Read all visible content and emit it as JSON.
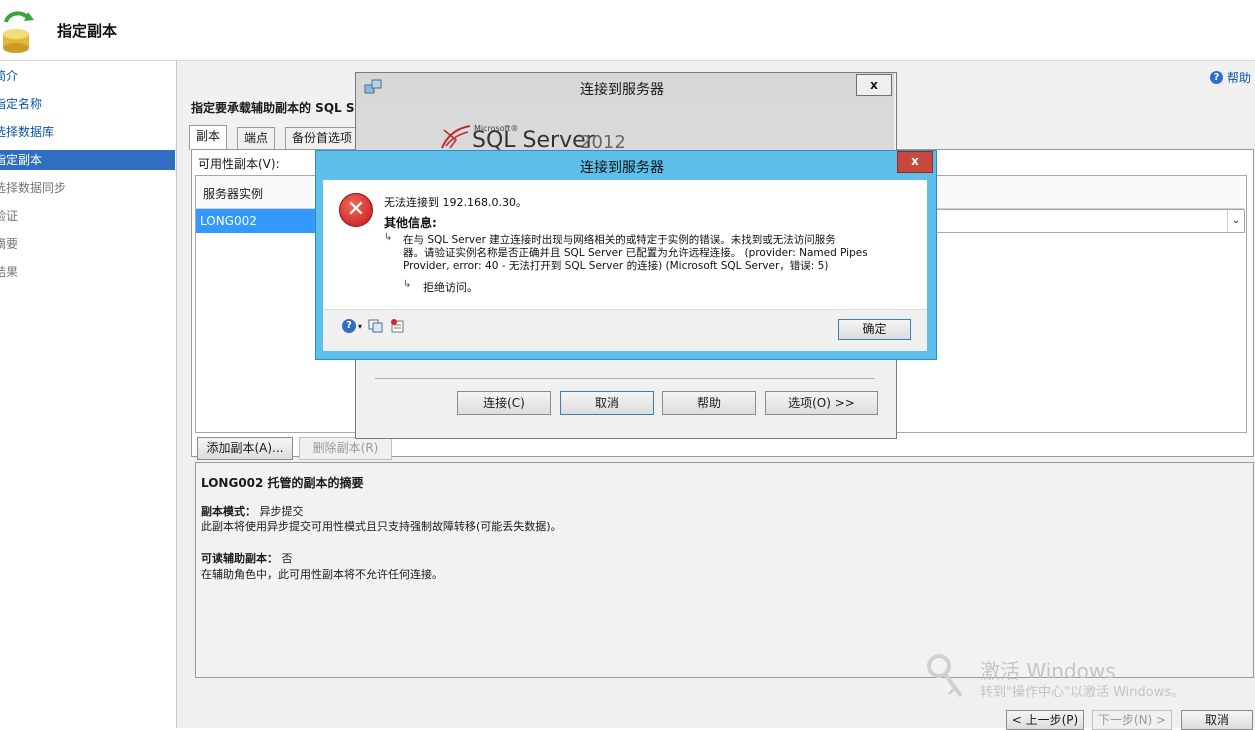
{
  "header": {
    "title": "指定副本"
  },
  "sidebar": {
    "items": [
      {
        "label": "简介"
      },
      {
        "label": "指定名称"
      },
      {
        "label": "选择数据库"
      },
      {
        "label": "指定副本"
      },
      {
        "label": "选择数据同步"
      },
      {
        "label": "验证"
      },
      {
        "label": "摘要"
      },
      {
        "label": "结果"
      }
    ]
  },
  "main": {
    "help": "帮助",
    "heading": "指定要承载辅助副本的 SQL Se",
    "tabs": [
      {
        "label": "副本"
      },
      {
        "label": "端点"
      },
      {
        "label": "备份首选项"
      }
    ],
    "availability_label": "可用性副本(V):",
    "column_header": "服务器实例",
    "row_value": "LONG002",
    "add_button": "添加副本(A)...",
    "remove_button": "删除副本(R)",
    "summary": {
      "title": "LONG002 托管的副本的摘要",
      "mode_label": "副本模式：",
      "mode_value": "异步提交",
      "mode_desc": "此副本将使用异步提交可用性模式且只支持强制故障转移(可能丢失数据)。",
      "readable_label": "可读辅助副本：",
      "readable_value": "否",
      "readable_desc": "在辅助角色中，此可用性副本将不允许任何连接。"
    }
  },
  "footer": {
    "prev": "< 上一步(P)",
    "next": "下一步(N) >",
    "cancel": "取消"
  },
  "watermark": {
    "title": "激活 Windows",
    "subtitle": "转到\"操作中心\"以激活 Windows。"
  },
  "connect_dialog": {
    "title": "连接到服务器",
    "close": "x",
    "logo_ms": "Microsoft®",
    "logo_product": "SQL Server",
    "logo_version": "2012",
    "buttons": {
      "connect": "连接(C)",
      "cancel": "取消",
      "help": "帮助",
      "options": "选项(O) >>"
    }
  },
  "error_dialog": {
    "title": "连接到服务器",
    "close": "x",
    "message": "无法连接到 192.168.0.30。",
    "more_info_label": "其他信息:",
    "detail_line1": "在与 SQL Server 建立连接时出现与网络相关的或特定于实例的错误。未找到或无法访问服务",
    "detail_line2": "器。请验证实例名称是否正确并且 SQL Server 已配置为允许远程连接。 (provider: Named Pipes",
    "detail_line3": "Provider, error: 40 - 无法打开到 SQL Server 的连接) (Microsoft SQL Server，错误: 5)",
    "inner_error": "拒绝访问。",
    "ok": "确定"
  }
}
